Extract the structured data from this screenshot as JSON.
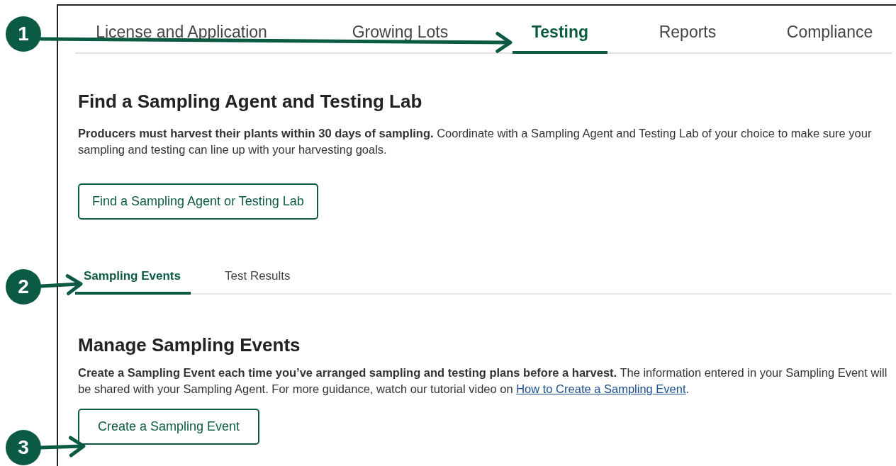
{
  "main_tabs": [
    {
      "label": "License and Application",
      "selected": false
    },
    {
      "label": "Growing Lots",
      "selected": false
    },
    {
      "label": "Testing",
      "selected": true
    },
    {
      "label": "Reports",
      "selected": false
    },
    {
      "label": "Compliance",
      "selected": false
    }
  ],
  "find_section": {
    "heading": "Find a Sampling Agent and Testing Lab",
    "text": "**Producers must harvest their plants within 30 days of sampling.** Coordinate with a Sampling Agent and Testing Lab of your choice to make sure your sampling and testing can line up with your harvesting goals.",
    "button": "Find a Sampling Agent or Testing Lab"
  },
  "sub_tabs": [
    {
      "label": "Sampling Events",
      "selected": true
    },
    {
      "label": "Test Results",
      "selected": false
    }
  ],
  "manage_section": {
    "heading": "Manage Sampling Events",
    "text": "**Create a Sampling Event each time you’ve arranged sampling and testing plans before a harvest.** The information entered in your Sampling Event will be shared with your Sampling Agent. For more guidance, watch our tutorial video on ",
    "link": "How to Create a Sampling Event",
    "after": ".",
    "button": "Create a Sampling Event"
  },
  "callouts": [
    {
      "number": "1"
    },
    {
      "number": "2"
    },
    {
      "number": "3"
    }
  ]
}
